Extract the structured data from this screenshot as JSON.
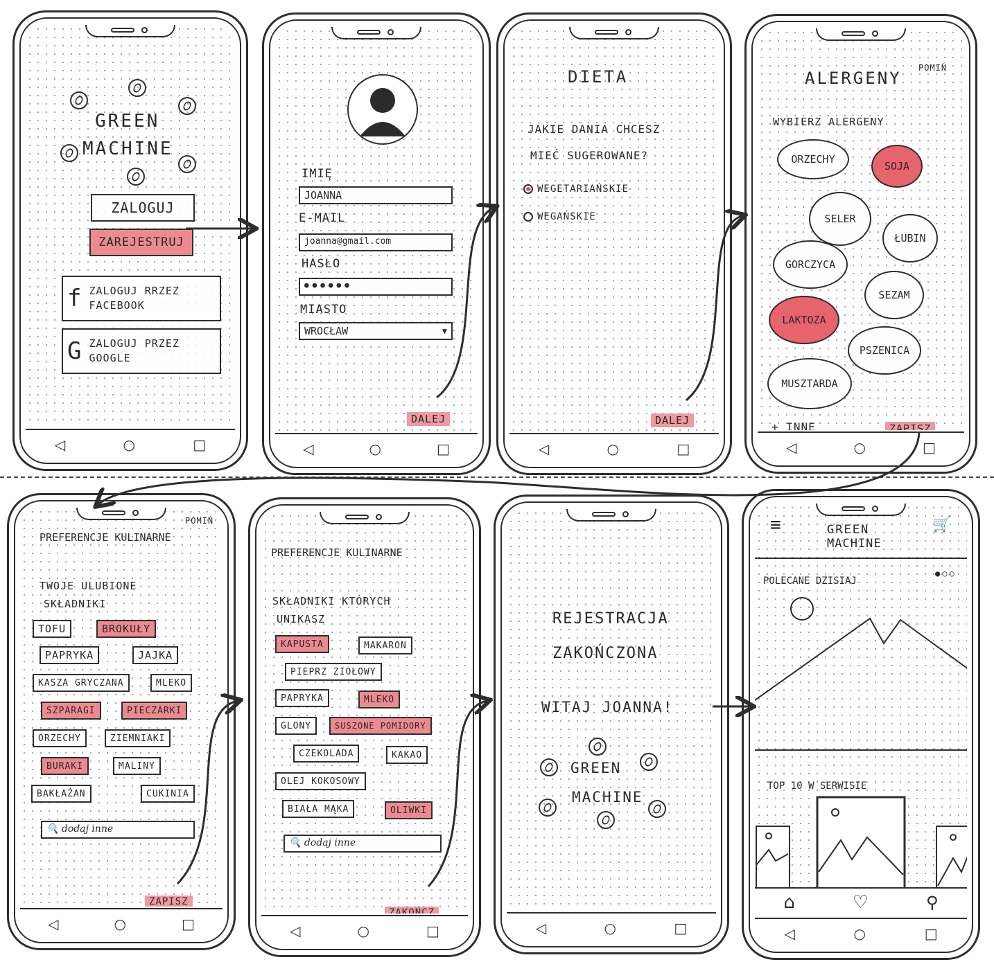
{
  "colors": {
    "accent": "#ec8a90",
    "accent_strong": "#e8646c",
    "ink": "#2e2e2e"
  },
  "nav": {
    "back": "◁",
    "home": "○",
    "recent": "□"
  },
  "s1": {
    "title_line1": "GREEN",
    "title_line2": "MACHINE",
    "login": "ZALOGUJ",
    "register": "ZAREJESTRUJ",
    "fb_icon": "f",
    "fb_line1": "ZALOGUJ RRZEZ",
    "fb_line2": "FACEBOOK",
    "google_icon": "G",
    "google_line1": "ZALOGUJ PRZEZ",
    "google_line2": "GOOGLE"
  },
  "s2": {
    "name_label": "IMIĘ",
    "name_value": "JOANNA",
    "email_label": "E-MAIL",
    "email_value": "joanna@gmail.com",
    "password_label": "HASŁO",
    "password_value": "●●●●●●",
    "city_label": "MIASTO",
    "city_value": "WROCŁAW",
    "dropdown_icon": "▼",
    "next": "DALEJ",
    "dots": "●○○○○"
  },
  "s3": {
    "title": "DIETA",
    "question_line1": "JAKIE DANIA CHCESZ",
    "question_line2": "MIEĆ SUGEROWANE?",
    "option1": "WEGETARIAŃSKIE",
    "option2": "WEGAŃSKIE",
    "next": "DALEJ",
    "dots": "○●○○○"
  },
  "s4": {
    "title": "ALERGENY",
    "skip": "POMIŃ",
    "subtitle": "WYBIERZ ALERGENY",
    "allergens": [
      "ORZECHY",
      "SOJA",
      "SELER",
      "ŁUBIN",
      "GORCZYCA",
      "SEZAM",
      "LAKTOZA",
      "PSZENICA",
      "MUSZTARDA"
    ],
    "selected": [
      "SOJA",
      "LAKTOZA"
    ],
    "other": "+ INNE",
    "save": "ZAPISZ",
    "dots": "○○●○○"
  },
  "s5": {
    "title": "PREFERENCJE KULINARNE",
    "skip": "POMIŃ",
    "subtitle_line1": "TWOJE ULUBIONE",
    "subtitle_line2": "SKŁADNIKI",
    "chips": [
      "TOFU",
      "BROKUŁY",
      "PAPRYKA",
      "JAJKA",
      "KASZA GRYCZANA",
      "MLEKO",
      "SZPARAGI",
      "PIECZARKI",
      "ORZECHY",
      "ZIEMNIAKI",
      "BURAKI",
      "MALINY",
      "BAKŁAŻAN",
      "CUKINIA"
    ],
    "search_placeholder": "🔍 dodaj inne",
    "save": "ZAPISZ",
    "dots": "○○○●○"
  },
  "s6": {
    "title": "PREFERENCJE KULINARNE",
    "subtitle_line1": "SKŁADNIKI KTÓRYCH",
    "subtitle_line2": "UNIKASZ",
    "chips": [
      "KAPUSTA",
      "MAKARON",
      "PIEPRZ ZIOŁOWY",
      "PAPRYKA",
      "MLEKO",
      "GLONY",
      "SUSZONE POMIDORY",
      "CZEKOLADA",
      "KAKAO",
      "OLEJ KOKOSOWY",
      "BIAŁA MĄKA",
      "OLIWKI"
    ],
    "search_placeholder": "🔍 dodaj inne",
    "finish": "ZAKOŃCZ",
    "dots": "○○○○●"
  },
  "s7": {
    "line1": "REJESTRACJA",
    "line2": "ZAKOŃCZONA",
    "welcome": "WITAJ JOANNA!",
    "brand1": "GREEN",
    "brand2": "MACHINE"
  },
  "s8": {
    "menu_icon": "≡",
    "brand1": "GREEN",
    "brand2": "MACHINE",
    "cart_icon": "🛒",
    "recommended": "POLECANE DZISIAJ",
    "carousel_dots": "●○○",
    "top10": "TOP 10 W SERWISIE",
    "tab_home": "⌂",
    "tab_fav": "♡",
    "tab_search": "⚲"
  }
}
